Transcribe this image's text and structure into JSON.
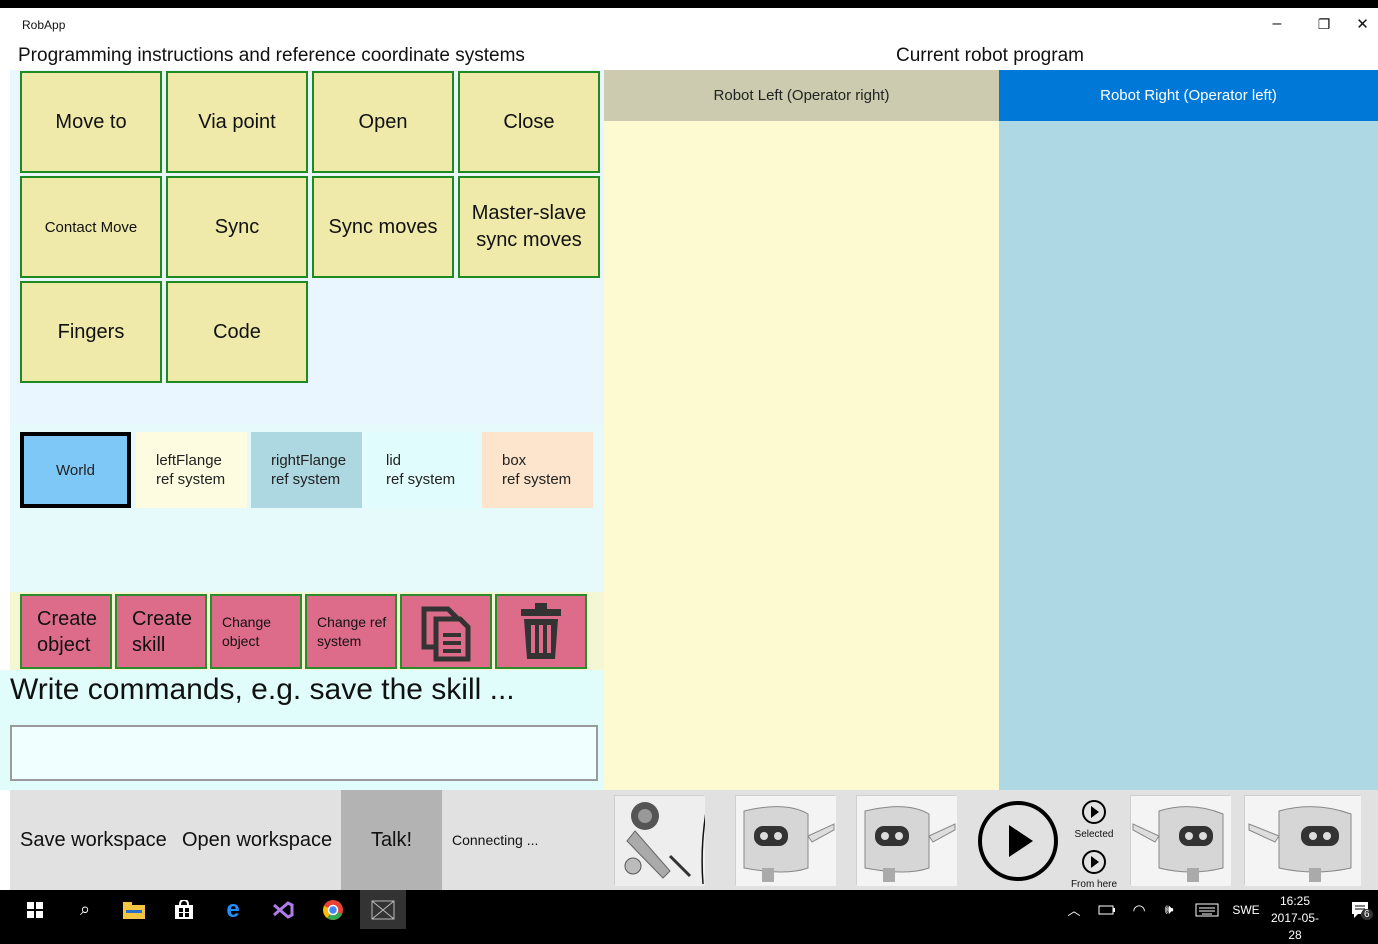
{
  "window": {
    "title": "RobApp",
    "controls": {
      "minimize": "–",
      "restore": "❐",
      "close": "✕"
    }
  },
  "left_section_title": "Programming instructions and reference coordinate systems",
  "right_section_title": "Current robot program",
  "instructions": [
    {
      "label": "Move to"
    },
    {
      "label": "Via point"
    },
    {
      "label": "Open"
    },
    {
      "label": "Close"
    },
    {
      "label": "Contact Move"
    },
    {
      "label": "Sync"
    },
    {
      "label": "Sync moves"
    },
    {
      "label": "Master-slave\nsync moves"
    },
    {
      "label": "Fingers"
    },
    {
      "label": "Code"
    }
  ],
  "ref_systems": [
    {
      "label": "World",
      "color": "#7ec8f7",
      "selected": true
    },
    {
      "label": "leftFlange\nref system",
      "color": "#fdfce0"
    },
    {
      "label": "rightFlange\nref system",
      "color": "#add7e1"
    },
    {
      "label": "lid\nref system",
      "color": "#e0fcfc"
    },
    {
      "label": "box\nref system",
      "color": "#fde4cc"
    }
  ],
  "actions": [
    {
      "label": "Create\nobject",
      "size": "large"
    },
    {
      "label": "Create\nskill",
      "size": "large"
    },
    {
      "label": "Change\nobject",
      "size": "small"
    },
    {
      "label": "Change ref\nsystem",
      "size": "small"
    },
    {
      "icon": "copy-icon"
    },
    {
      "icon": "trash-icon"
    }
  ],
  "command": {
    "label": "Write commands, e.g. save the skill ...",
    "value": "",
    "placeholder": ""
  },
  "program_columns": [
    {
      "label": "Robot Left (Operator right)",
      "header_color": "#cccbb0",
      "body_color": "#fdf9d1",
      "text_color": "#222222"
    },
    {
      "label": "Robot Right (Operator left)",
      "header_color": "#0078d7",
      "body_color": "#add8e4",
      "text_color": "#ffffff"
    }
  ],
  "bottom_bar": {
    "save": "Save workspace",
    "open": "Open workspace",
    "talk": "Talk!",
    "status": "Connecting ...",
    "play_selected": "Selected",
    "play_from_here": "From here"
  },
  "taskbar": {
    "language": "SWE",
    "time": "16:25",
    "date": "2017-05-28",
    "notifications": "6"
  }
}
